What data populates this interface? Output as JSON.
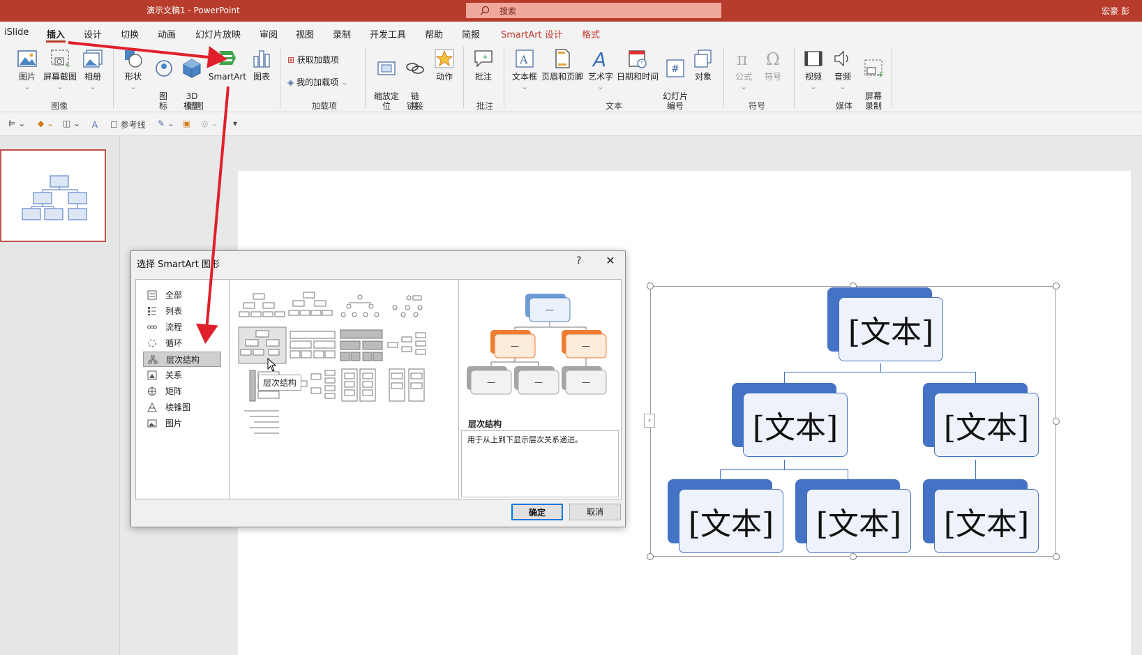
{
  "window": {
    "title": "演示文稿1 - PowerPoint",
    "search_placeholder": "搜索",
    "user": "宏豪 彭"
  },
  "tabs": [
    "iSlide",
    "插入",
    "设计",
    "切换",
    "动画",
    "幻灯片放映",
    "审阅",
    "视图",
    "录制",
    "开发工具",
    "帮助",
    "简报",
    "SmartArt 设计",
    "格式"
  ],
  "active_tab": "插入",
  "ribbon": {
    "images": {
      "label": "图像",
      "pictures": "图片",
      "screenshot": "屏幕截图",
      "album": "相册"
    },
    "illustrations": {
      "label": "插图",
      "shapes": "形状",
      "icons": "图\n标",
      "models3d": "3D\n模型",
      "smartart": "SmartArt",
      "chart": "图表"
    },
    "addins": {
      "label": "加载项",
      "get_addins": "获取加载项",
      "my_addins": "我的加载项"
    },
    "links": {
      "label": "链接",
      "zoom": "缩放定\n位",
      "link": "链\n接",
      "action": "动作"
    },
    "comments": {
      "label": "批注",
      "comment": "批注"
    },
    "text": {
      "label": "文本",
      "textbox": "文本框",
      "header_footer": "页眉和页脚",
      "wordart": "艺术字",
      "datetime": "日期和时间",
      "slide_number": "幻灯片\n编号",
      "object": "对象"
    },
    "symbols": {
      "label": "符号",
      "equation": "公式",
      "symbol": "符号"
    },
    "media": {
      "label": "媒体",
      "video": "视频",
      "audio": "音频",
      "screen_record": "屏幕\n录制"
    }
  },
  "quick_toolbar": {
    "guides": "参考线"
  },
  "slide": {
    "nodes": [
      "[文本]",
      "[文本]",
      "[文本]",
      "[文本]",
      "[文本]",
      "[文本]"
    ]
  },
  "dialog": {
    "title": "选择 SmartArt 图形",
    "help": "?",
    "close": "✕",
    "categories": [
      "全部",
      "列表",
      "流程",
      "循环",
      "层次结构",
      "关系",
      "矩阵",
      "棱锥图",
      "图片"
    ],
    "selected_category": "层次结构",
    "tooltip": "层次结构",
    "preview_name": "层次结构",
    "preview_desc": "用于从上到下显示层次关系递进。",
    "preview_placeholder": "—",
    "ok": "确定",
    "cancel": "取消"
  },
  "colors": {
    "accent": "#b83c2b",
    "smartart_blue": "#4472c4",
    "arrow_red": "#e0202a",
    "preview_orange": "#ed7d31"
  }
}
